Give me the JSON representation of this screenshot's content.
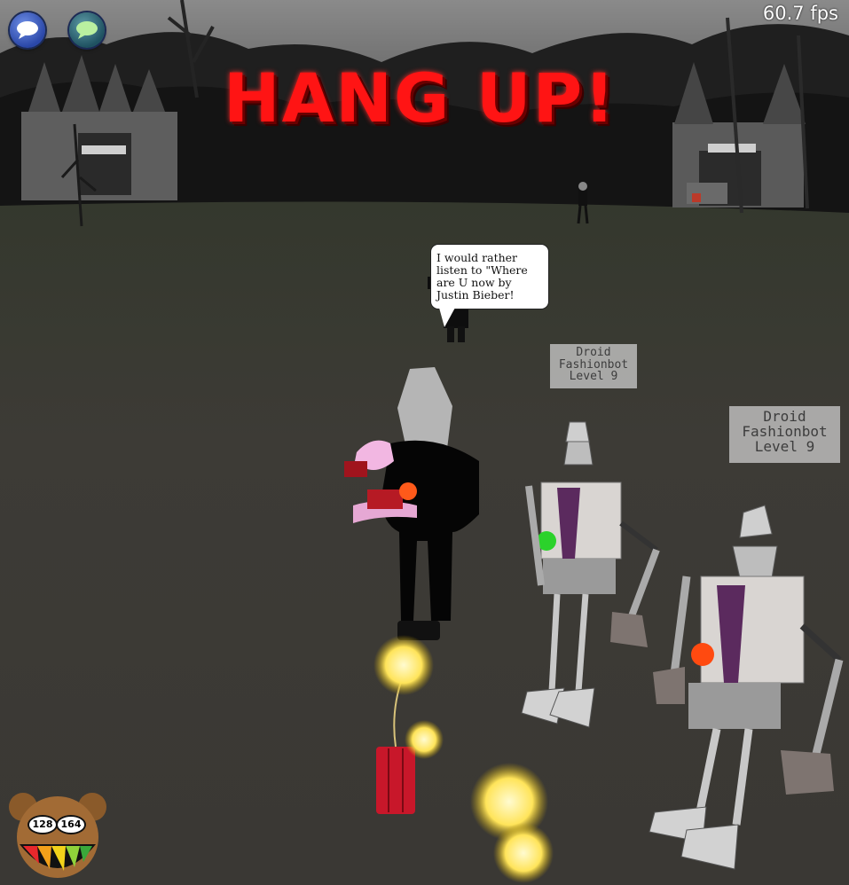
{
  "hud": {
    "fps": "60.7 fps",
    "banner": "HANG UP!",
    "speedchat_icon": "speech-bubble-icon",
    "whisper_icon": "green-speech-bubble-icon"
  },
  "speech_bubble": {
    "text": "I would rather listen to \"Where are U now by Justin Bieber!"
  },
  "cogs": [
    {
      "name": "Droid",
      "line2": "Fashionbot",
      "level": "Level 9"
    },
    {
      "name": "Droid",
      "line2": "Fashionbot",
      "level": "Level 9"
    }
  ],
  "laff_meter": {
    "current": "128",
    "max": "164"
  },
  "colors": {
    "banner": "#ff1414",
    "ground": "#3b3935",
    "sky": "#6d6d6d"
  }
}
